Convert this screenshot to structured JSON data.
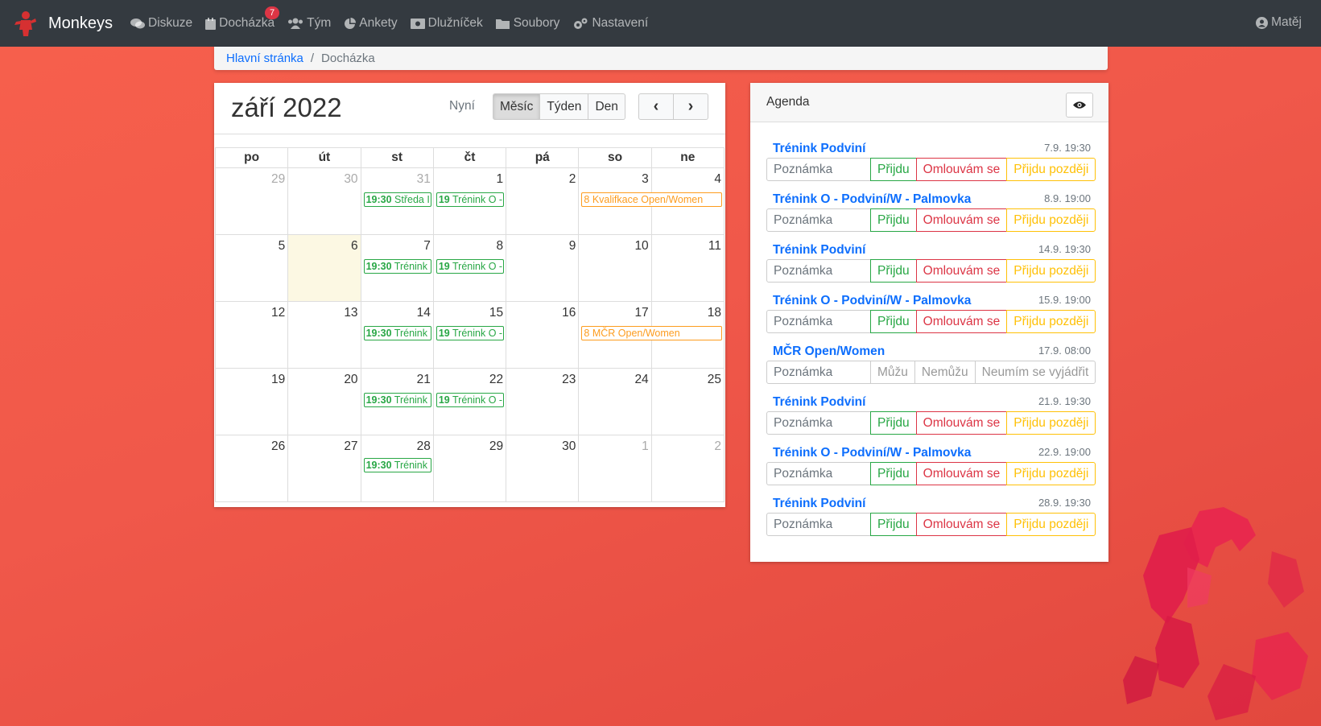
{
  "navbar": {
    "brand": "Monkeys",
    "items": [
      {
        "label": "Diskuze",
        "icon": "comments-icon"
      },
      {
        "label": "Docházka",
        "icon": "calendar-icon",
        "badge": "7"
      },
      {
        "label": "Tým",
        "icon": "users-icon"
      },
      {
        "label": "Ankety",
        "icon": "chart-pie-icon"
      },
      {
        "label": "Dlužníček",
        "icon": "money-icon"
      },
      {
        "label": "Soubory",
        "icon": "folder-icon"
      },
      {
        "label": "Nastavení",
        "icon": "cogs-icon"
      }
    ],
    "user": "Matěj"
  },
  "breadcrumb": {
    "home": "Hlavní stránka",
    "current": "Docházka"
  },
  "calendar": {
    "title": "září 2022",
    "now_label": "Nyní",
    "views": [
      "Měsíc",
      "Týden",
      "Den"
    ],
    "active_view": "Měsíc",
    "prev": "‹",
    "next": "›",
    "weekdays": [
      "po",
      "út",
      "st",
      "čt",
      "pá",
      "so",
      "ne"
    ],
    "weeks": [
      {
        "days": [
          "29",
          "30",
          "31",
          "1",
          "2",
          "3",
          "4"
        ]
      },
      {
        "days": [
          "5",
          "6",
          "7",
          "8",
          "9",
          "10",
          "11"
        ]
      },
      {
        "days": [
          "12",
          "13",
          "14",
          "15",
          "16",
          "17",
          "18"
        ]
      },
      {
        "days": [
          "19",
          "20",
          "21",
          "22",
          "23",
          "24",
          "25"
        ]
      },
      {
        "days": [
          "26",
          "27",
          "28",
          "29",
          "30",
          "1",
          "2"
        ]
      }
    ],
    "events": {
      "w0_st": {
        "time": "19:30",
        "title": "Středa I"
      },
      "w0_ct": {
        "time": "19",
        "title": "Trénink O -"
      },
      "w0_so": {
        "time": "8",
        "title": "Kvalifkace Open/Women"
      },
      "w1_st": {
        "time": "19:30",
        "title": "Trénink"
      },
      "w1_ct": {
        "time": "19",
        "title": "Trénink O -"
      },
      "w2_st": {
        "time": "19:30",
        "title": "Trénink"
      },
      "w2_ct": {
        "time": "19",
        "title": "Trénink O -"
      },
      "w2_so": {
        "time": "8",
        "title": "MČR Open/Women"
      },
      "w3_st": {
        "time": "19:30",
        "title": "Trénink"
      },
      "w3_ct": {
        "time": "19",
        "title": "Trénink O -"
      },
      "w4_st": {
        "time": "19:30",
        "title": "Trénink"
      }
    }
  },
  "agenda": {
    "title": "Agenda",
    "note_placeholder": "Poznámka",
    "items": [
      {
        "title": "Trénink Podviní",
        "date": "7.9. 19:30",
        "options": [
          "Přijdu",
          "Omlouvám se",
          "Přijdu později"
        ]
      },
      {
        "title": "Trénink O - Podviní/W - Palmovka",
        "date": "8.9. 19:00",
        "options": [
          "Přijdu",
          "Omlouvám se",
          "Přijdu později"
        ]
      },
      {
        "title": "Trénink Podviní",
        "date": "14.9. 19:30",
        "options": [
          "Přijdu",
          "Omlouvám se",
          "Přijdu později"
        ]
      },
      {
        "title": "Trénink O - Podviní/W - Palmovka",
        "date": "15.9. 19:00",
        "options": [
          "Přijdu",
          "Omlouvám se",
          "Přijdu později"
        ]
      },
      {
        "title": "MČR Open/Women",
        "date": "17.9. 08:00",
        "options": [
          "Můžu",
          "Nemůžu",
          "Neumím se vyjádřit"
        ]
      },
      {
        "title": "Trénink Podviní",
        "date": "21.9. 19:30",
        "options": [
          "Přijdu",
          "Omlouvám se",
          "Přijdu později"
        ]
      },
      {
        "title": "Trénink O - Podviní/W - Palmovka",
        "date": "22.9. 19:00",
        "options": [
          "Přijdu",
          "Omlouvám se",
          "Přijdu později"
        ]
      },
      {
        "title": "Trénink Podviní",
        "date": "28.9. 19:30",
        "options": [
          "Přijdu",
          "Omlouvám se",
          "Přijdu později"
        ]
      }
    ]
  },
  "colors": {
    "background": "#f0584a",
    "navbar": "#343a40",
    "link": "#0d6efd",
    "success": "#28a745",
    "danger": "#dc3545",
    "warning": "#ffc107",
    "event_orange": "#fd9c1e",
    "today": "#fcf8e3"
  }
}
